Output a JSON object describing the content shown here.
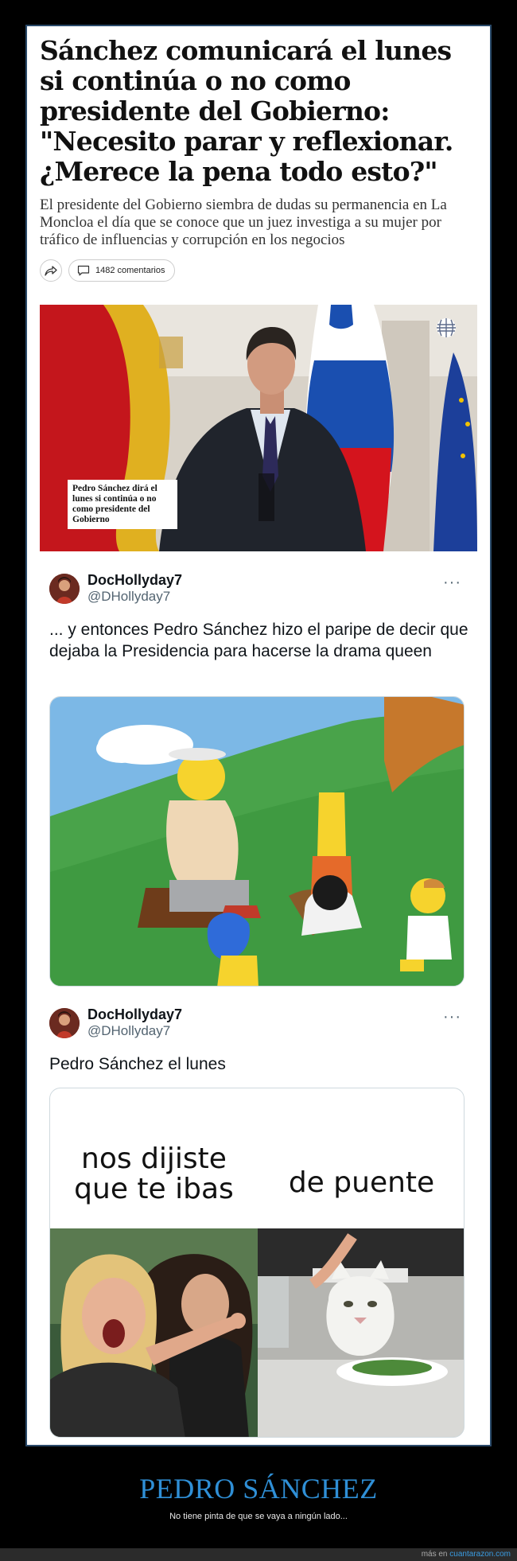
{
  "article": {
    "headline": "Sánchez comunicará el lunes si continúa o no como presidente del Gobierno: \"Necesito parar y reflexionar. ¿Merece la pena todo esto?\"",
    "lede": "El presidente del Gobierno siembra de dudas su permanencia en La Moncloa el día que se conoce que un juez investiga a su mujer por tráfico de influencias y corrupción en los negocios",
    "comments_label": "1482 comentarios",
    "photo_caption": "Pedro Sánchez dirá el lunes si continúa o no como presidente del Gobierno"
  },
  "tweets": [
    {
      "display_name": "DocHollyday7",
      "handle": "@DHollyday7",
      "more": "···",
      "text": "... y entonces Pedro Sánchez hizo el paripe de decir que dejaba la Presidencia para hacerse la drama queen"
    },
    {
      "display_name": "DocHollyday7",
      "handle": "@DHollyday7",
      "more": "···",
      "text": "Pedro Sánchez el lunes",
      "meme_left": "nos dijiste que te ibas",
      "meme_right": "de puente"
    }
  ],
  "footer": {
    "title": "PEDRO SÁNCHEZ",
    "subtitle": "No tiene pinta de que se vaya a ningún lado...",
    "credit_prefix": "más en",
    "credit_site": "cuantarazon.com"
  },
  "colors": {
    "frame_border": "#2a4a6a",
    "footer_title": "#2f8fd6",
    "link": "#3a9be0"
  }
}
